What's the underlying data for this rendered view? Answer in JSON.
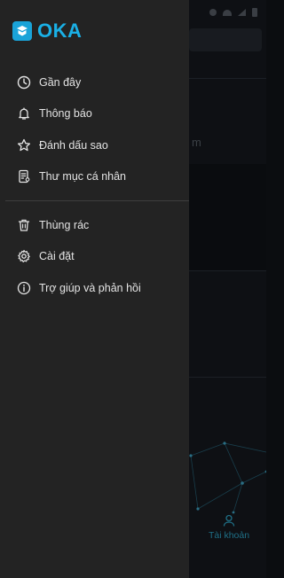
{
  "brand": {
    "name": "OKA",
    "accent": "#1aa3d8"
  },
  "menu_primary": [
    {
      "label": "Gần đây",
      "icon": "clock-icon"
    },
    {
      "label": "Thông báo",
      "icon": "bell-icon"
    },
    {
      "label": "Đánh dấu sao",
      "icon": "star-icon"
    },
    {
      "label": "Thư mục cá nhân",
      "icon": "personal-folder-icon"
    }
  ],
  "menu_secondary": [
    {
      "label": "Thùng rác",
      "icon": "trash-icon"
    },
    {
      "label": "Cài đặt",
      "icon": "gear-icon"
    },
    {
      "label": "Trợ giúp và phản hồi",
      "icon": "info-icon"
    }
  ],
  "background": {
    "partial_text": "m",
    "bottom_nav_account_label": "Tài khoản"
  }
}
